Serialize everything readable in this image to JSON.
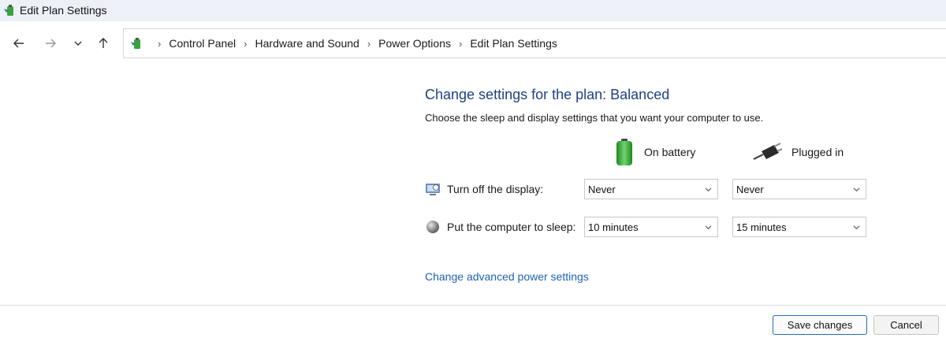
{
  "window": {
    "title": "Edit Plan Settings"
  },
  "nav": {
    "back_icon": "arrow-left-icon",
    "forward_icon": "arrow-right-icon",
    "recent_icon": "chevron-down-icon",
    "up_icon": "arrow-up-icon"
  },
  "breadcrumb": {
    "items": [
      "Control Panel",
      "Hardware and Sound",
      "Power Options",
      "Edit Plan Settings"
    ]
  },
  "main": {
    "heading": "Change settings for the plan: Balanced",
    "subtext": "Choose the sleep and display settings that you want your computer to use.",
    "columns": {
      "battery": "On battery",
      "plugged": "Plugged in"
    },
    "rows": [
      {
        "label": "Turn off the display:",
        "battery": "Never",
        "plugged": "Never"
      },
      {
        "label": "Put the computer to sleep:",
        "battery": "10 minutes",
        "plugged": "15 minutes"
      }
    ],
    "advanced_link": "Change advanced power settings"
  },
  "footer": {
    "save_label": "Save changes",
    "cancel_label": "Cancel"
  },
  "colors": {
    "heading": "#1e3f86",
    "link": "#1e63b6",
    "accent_border": "#1f6fbf"
  }
}
